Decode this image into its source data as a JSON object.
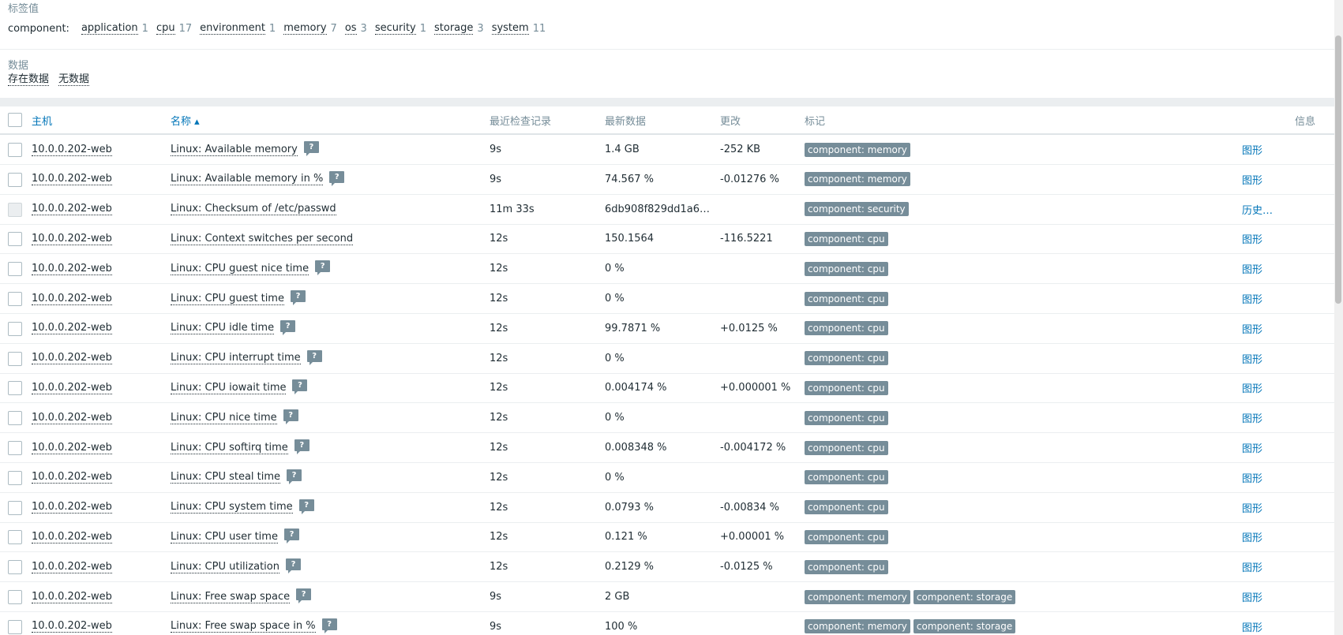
{
  "filters": {
    "tag_values_title": "标签值",
    "tag_key": "component:",
    "tags": [
      {
        "name": "application",
        "count": "1"
      },
      {
        "name": "cpu",
        "count": "17"
      },
      {
        "name": "environment",
        "count": "1"
      },
      {
        "name": "memory",
        "count": "7"
      },
      {
        "name": "os",
        "count": "3"
      },
      {
        "name": "security",
        "count": "1"
      },
      {
        "name": "storage",
        "count": "3"
      },
      {
        "name": "system",
        "count": "11"
      }
    ],
    "data_title": "数据",
    "data_options": [
      "存在数据",
      "无数据"
    ]
  },
  "table": {
    "headers": {
      "host": "主机",
      "name": "名称 ▴",
      "last_check": "最近检查记录",
      "last_value": "最新数据",
      "change": "更改",
      "tags": "标记",
      "info": "信息"
    },
    "rows": [
      {
        "host": "10.0.0.202-web",
        "name": "Linux: Available memory",
        "hint": "?",
        "last_check": "9s",
        "last_value": "1.4 GB",
        "change": "-252 KB",
        "tags": [
          "component: memory"
        ],
        "action": "图形",
        "disabled": false
      },
      {
        "host": "10.0.0.202-web",
        "name": "Linux: Available memory in %",
        "hint": "?",
        "last_check": "9s",
        "last_value": "74.567 %",
        "change": "-0.01276 %",
        "tags": [
          "component: memory"
        ],
        "action": "图形",
        "disabled": false
      },
      {
        "host": "10.0.0.202-web",
        "name": "Linux: Checksum of /etc/passwd",
        "hint": "",
        "last_check": "11m 33s",
        "last_value": "6db908f829dd1a6…",
        "change": "",
        "tags": [
          "component: security"
        ],
        "action": "历史…",
        "disabled": true
      },
      {
        "host": "10.0.0.202-web",
        "name": "Linux: Context switches per second",
        "hint": "",
        "last_check": "12s",
        "last_value": "150.1564",
        "change": "-116.5221",
        "tags": [
          "component: cpu"
        ],
        "action": "图形",
        "disabled": false
      },
      {
        "host": "10.0.0.202-web",
        "name": "Linux: CPU guest nice time",
        "hint": "?",
        "last_check": "12s",
        "last_value": "0 %",
        "change": "",
        "tags": [
          "component: cpu"
        ],
        "action": "图形",
        "disabled": false
      },
      {
        "host": "10.0.0.202-web",
        "name": "Linux: CPU guest time",
        "hint": "?",
        "last_check": "12s",
        "last_value": "0 %",
        "change": "",
        "tags": [
          "component: cpu"
        ],
        "action": "图形",
        "disabled": false
      },
      {
        "host": "10.0.0.202-web",
        "name": "Linux: CPU idle time",
        "hint": "?",
        "last_check": "12s",
        "last_value": "99.7871 %",
        "change": "+0.0125 %",
        "tags": [
          "component: cpu"
        ],
        "action": "图形",
        "disabled": false
      },
      {
        "host": "10.0.0.202-web",
        "name": "Linux: CPU interrupt time",
        "hint": "?",
        "last_check": "12s",
        "last_value": "0 %",
        "change": "",
        "tags": [
          "component: cpu"
        ],
        "action": "图形",
        "disabled": false
      },
      {
        "host": "10.0.0.202-web",
        "name": "Linux: CPU iowait time",
        "hint": "?",
        "last_check": "12s",
        "last_value": "0.004174 %",
        "change": "+0.000001 %",
        "tags": [
          "component: cpu"
        ],
        "action": "图形",
        "disabled": false
      },
      {
        "host": "10.0.0.202-web",
        "name": "Linux: CPU nice time",
        "hint": "?",
        "last_check": "12s",
        "last_value": "0 %",
        "change": "",
        "tags": [
          "component: cpu"
        ],
        "action": "图形",
        "disabled": false
      },
      {
        "host": "10.0.0.202-web",
        "name": "Linux: CPU softirq time",
        "hint": "?",
        "last_check": "12s",
        "last_value": "0.008348 %",
        "change": "-0.004172 %",
        "tags": [
          "component: cpu"
        ],
        "action": "图形",
        "disabled": false
      },
      {
        "host": "10.0.0.202-web",
        "name": "Linux: CPU steal time",
        "hint": "?",
        "last_check": "12s",
        "last_value": "0 %",
        "change": "",
        "tags": [
          "component: cpu"
        ],
        "action": "图形",
        "disabled": false
      },
      {
        "host": "10.0.0.202-web",
        "name": "Linux: CPU system time",
        "hint": "?",
        "last_check": "12s",
        "last_value": "0.0793 %",
        "change": "-0.00834 %",
        "tags": [
          "component: cpu"
        ],
        "action": "图形",
        "disabled": false
      },
      {
        "host": "10.0.0.202-web",
        "name": "Linux: CPU user time",
        "hint": "?",
        "last_check": "12s",
        "last_value": "0.121 %",
        "change": "+0.00001 %",
        "tags": [
          "component: cpu"
        ],
        "action": "图形",
        "disabled": false
      },
      {
        "host": "10.0.0.202-web",
        "name": "Linux: CPU utilization",
        "hint": "?",
        "last_check": "12s",
        "last_value": "0.2129 %",
        "change": "-0.0125 %",
        "tags": [
          "component: cpu"
        ],
        "action": "图形",
        "disabled": false
      },
      {
        "host": "10.0.0.202-web",
        "name": "Linux: Free swap space",
        "hint": "?",
        "last_check": "9s",
        "last_value": "2 GB",
        "change": "",
        "tags": [
          "component: memory",
          "component: storage"
        ],
        "action": "图形",
        "disabled": false
      },
      {
        "host": "10.0.0.202-web",
        "name": "Linux: Free swap space in %",
        "hint": "?",
        "last_check": "9s",
        "last_value": "100 %",
        "change": "",
        "tags": [
          "component: memory",
          "component: storage"
        ],
        "action": "图形",
        "disabled": false
      }
    ]
  }
}
